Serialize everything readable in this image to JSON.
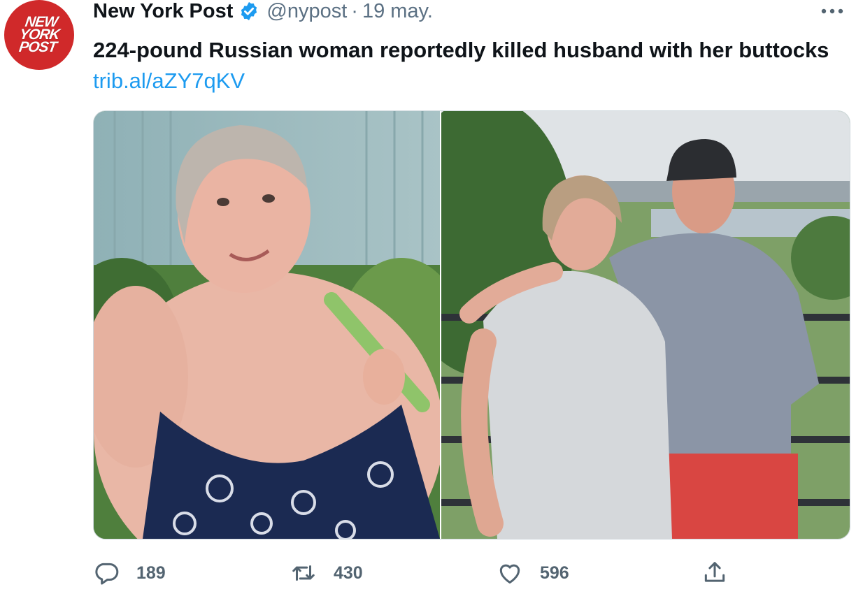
{
  "tweet": {
    "author_name": "New York Post",
    "handle": "@nypost",
    "separator": "·",
    "date": "19 may.",
    "logo_lines": [
      "NEW",
      "YORK",
      "POST"
    ],
    "text": "224-pound Russian woman reportedly killed husband with her buttocks",
    "link_text": "trib.al/aZY7qKV"
  },
  "metrics": {
    "replies": "189",
    "retweets": "430",
    "likes": "596"
  },
  "colors": {
    "brand_red": "#d0292a",
    "verified_blue": "#1d9bf0",
    "link_blue": "#1d9bf0",
    "muted_text": "#5b7083"
  },
  "icons": [
    "verified-badge-icon",
    "more-options-icon",
    "reply-icon",
    "retweet-icon",
    "like-icon",
    "share-icon"
  ]
}
